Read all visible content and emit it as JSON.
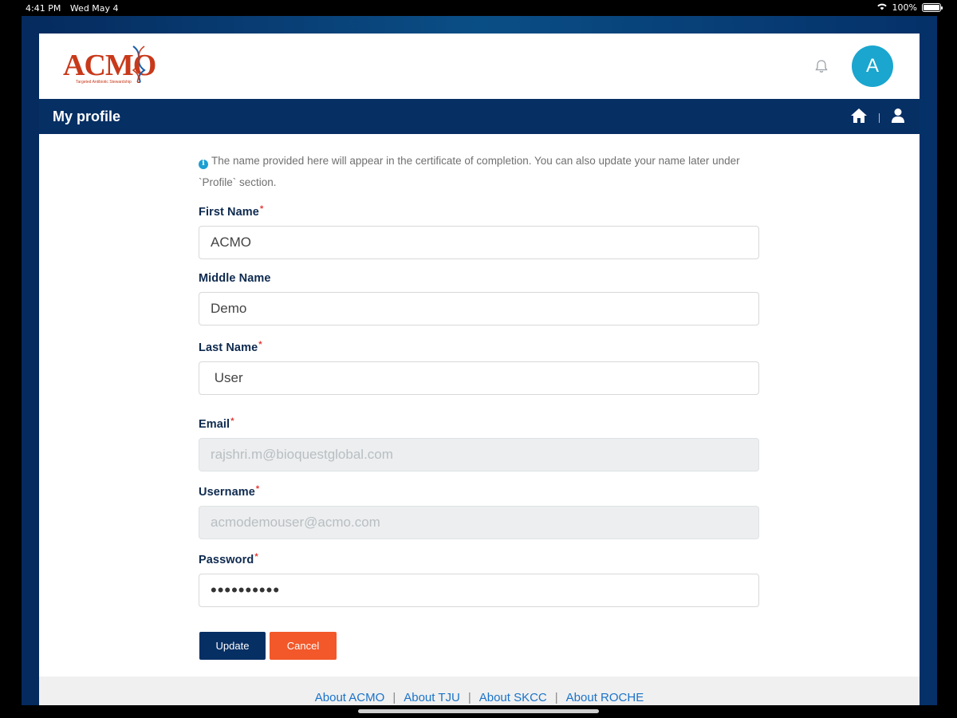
{
  "status_bar": {
    "time": "4:41 PM",
    "date": "Wed May 4",
    "battery": "100%"
  },
  "header": {
    "logo_text": "ACMO",
    "logo_subtitle": "Targeted Antibiotic Stewardship",
    "avatar_letter": "A"
  },
  "navbar": {
    "title": "My profile"
  },
  "info": {
    "text": "The name provided here will appear in the certificate of completion. You can also update your name later under `Profile` section."
  },
  "form": {
    "first_name": {
      "label": "First Name",
      "value": "ACMO",
      "required": "*"
    },
    "middle_name": {
      "label": "Middle Name",
      "value": "Demo"
    },
    "last_name": {
      "label": "Last Name",
      "value": " User",
      "required": "*"
    },
    "email": {
      "label": "Email",
      "value": "rajshri.m@bioquestglobal.com",
      "required": "*"
    },
    "username": {
      "label": "Username",
      "value": "acmodemouser@acmo.com",
      "required": "*"
    },
    "password": {
      "label": "Password",
      "value": "••••••••••",
      "required": "*"
    }
  },
  "buttons": {
    "update": "Update",
    "cancel": "Cancel"
  },
  "footer": {
    "links": [
      "About ACMO",
      "About TJU",
      "About SKCC",
      "About ROCHE"
    ],
    "separator": "|"
  },
  "colors": {
    "navy": "#062f64",
    "accent_orange": "#f2582a",
    "avatar_blue": "#1aa6cf",
    "logo_red": "#c8391a"
  }
}
